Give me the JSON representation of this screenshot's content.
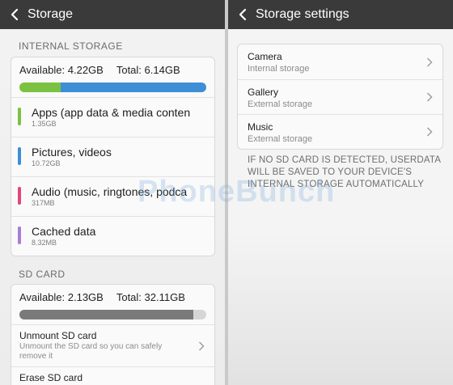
{
  "left": {
    "title": "Storage",
    "internal": {
      "header": "INTERNAL STORAGE",
      "available": "Available: 4.22GB",
      "total": "Total: 6.14GB",
      "bar": [
        {
          "fraction": 0.22,
          "color": "#7cc242"
        },
        {
          "fraction": 0.78,
          "color": "#3e8ed6"
        }
      ],
      "items": [
        {
          "label": "Apps (app data & media conten",
          "size": "1.35GB",
          "color": "#7cc242"
        },
        {
          "label": "Pictures, videos",
          "size": "10.72GB",
          "color": "#3e8ed6"
        },
        {
          "label": "Audio (music, ringtones, podca",
          "size": "317MB",
          "color": "#e0487c"
        },
        {
          "label": "Cached data",
          "size": "8.32MB",
          "color": "#a77ed8"
        }
      ]
    },
    "sd": {
      "header": "SD CARD",
      "available": "Available: 2.13GB",
      "total": "Total: 32.11GB",
      "bar": [
        {
          "fraction": 0.93,
          "color": "#7a7a7a"
        }
      ],
      "actions": [
        {
          "label": "Unmount SD card",
          "desc": "Unmount the SD card so you can safely remove it"
        },
        {
          "label": "Erase SD card",
          "desc": ""
        }
      ]
    }
  },
  "right": {
    "title": "Storage settings",
    "items": [
      {
        "label": "Camera",
        "sub": "Internal storage"
      },
      {
        "label": "Gallery",
        "sub": "External storage"
      },
      {
        "label": "Music",
        "sub": "External storage"
      }
    ],
    "note": "IF NO SD CARD IS DETECTED, USERDATA WILL BE SAVED TO YOUR DEVICE'S INTERNAL STORAGE AUTOMATICALLY"
  },
  "watermark": "PhoneBunch"
}
